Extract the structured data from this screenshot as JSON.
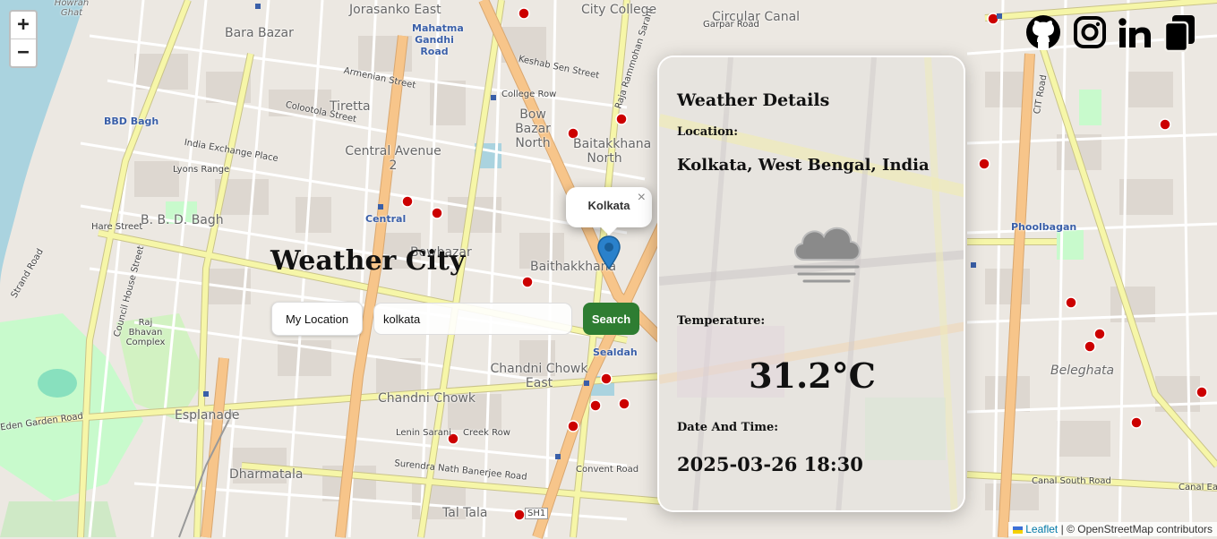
{
  "map": {
    "zoom_in": "+",
    "zoom_out": "−",
    "labels": [
      "Jorasanko East",
      "City College",
      "Circular Canal",
      "Garpar Road",
      "Bara Bazar",
      "Mahatma Gandhi Road",
      "Keshab Sen Street",
      "Armenian Street",
      "Tiretta",
      "Bow Bazar North",
      "Baitakkhana North",
      "Central Avenue 2",
      "College Row",
      "Raja Rammohan Sarani",
      "Colootola Street",
      "India Exchange Place",
      "BBD Bagh",
      "Lyons Range",
      "B. B. D. Bagh",
      "Central",
      "Hare Street",
      "Bowbazar",
      "Baithakkhana",
      "Chandni Chowk",
      "Chandni Chowk East",
      "Sealdah",
      "Esplanade",
      "Lenin Sarani",
      "Dharmatala",
      "Tal Tala",
      "Surendra Nath Banerjee Road",
      "Convent Road",
      "Raj Bhavan Complex",
      "Council House Street",
      "Strand Road",
      "Phoolbagan",
      "Beleghata",
      "CIT Road",
      "Canal South Road",
      "Canal East",
      "Howrah Ghat",
      "Eden Garden Road",
      "Creek Row",
      "SH1"
    ]
  },
  "app": {
    "title": "Weather City",
    "my_location_label": "My Location",
    "search_value": "kolkata",
    "search_label": "Search"
  },
  "popup": {
    "text": "Kolkata",
    "close": "×"
  },
  "weather": {
    "heading": "Weather Details",
    "location_label": "Location:",
    "location_value": "Kolkata, West Bengal, India",
    "icon": "cloud-fog-icon",
    "temperature_label": "Temperature:",
    "temperature_value": "31.2°C",
    "datetime_label": "Date And Time:",
    "datetime_value": "2025-03-26 18:30"
  },
  "social": [
    "github-icon",
    "instagram-icon",
    "linkedin-icon",
    "copy-icon"
  ],
  "attribution": {
    "leaflet": "Leaflet",
    "separator": "|",
    "osm": "© OpenStreetMap contributors"
  },
  "colors": {
    "search_button": "#2e7d32",
    "marker": "#2a81cb",
    "road_primary": "#f7c58a",
    "road_secondary": "#f6f6a8",
    "water": "#aad3df",
    "park": "#c8facc"
  }
}
